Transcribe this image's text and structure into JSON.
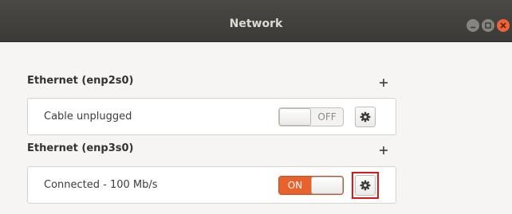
{
  "window": {
    "title": "Network"
  },
  "sections": [
    {
      "heading": "Ethernet (enp2s0)",
      "status": "Cable unplugged",
      "toggle_label": "OFF",
      "toggle_state": "off",
      "settings_icon": "gear-icon"
    },
    {
      "heading": "Ethernet (enp3s0)",
      "status": "Connected - 100 Mb/s",
      "toggle_label": "ON",
      "toggle_state": "on",
      "settings_icon": "gear-icon",
      "highlight_color": "#e01515"
    }
  ],
  "colors": {
    "titlebar": "#3b3a36",
    "accent": "#e8622e",
    "close_button": "#ec6337"
  }
}
